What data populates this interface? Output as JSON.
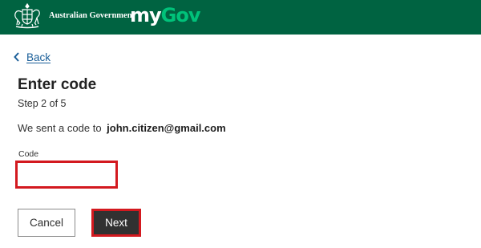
{
  "header": {
    "government_name": "Australian Government",
    "logo": {
      "my": "my",
      "gov": "Gov"
    },
    "crest_icon": "coat-of-arms-icon",
    "background_color": "#006341",
    "logo_accent_color": "#00c27a"
  },
  "nav": {
    "back_label": "Back",
    "back_icon": "chevron-left-icon"
  },
  "main": {
    "title": "Enter code",
    "step": "Step 2 of 5",
    "sent_prefix": "We sent a code to",
    "email": "john.citizen@gmail.com",
    "code_label": "Code",
    "code_value": "",
    "highlight_color": "#d3191f"
  },
  "actions": {
    "cancel_label": "Cancel",
    "next_label": "Next"
  }
}
